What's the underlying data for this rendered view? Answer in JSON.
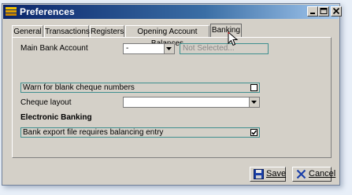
{
  "window": {
    "title": "Preferences",
    "icon": "stacked-bars-icon"
  },
  "tabs": [
    {
      "label": "General"
    },
    {
      "label": "Transactions"
    },
    {
      "label": "Registers"
    },
    {
      "label": "Opening Account Balances"
    },
    {
      "label": "Banking",
      "active": true
    }
  ],
  "banking": {
    "main_bank_account_label": "Main Bank Account",
    "main_bank_account_value": "-",
    "main_bank_account_display": "Not Selected...",
    "warn_blank_cheque_label": "Warn for blank cheque numbers",
    "warn_blank_cheque_checked": false,
    "cheque_layout_label": "Cheque layout",
    "cheque_layout_value": "",
    "electronic_banking_title": "Electronic Banking",
    "bank_export_label": "Bank export file requires balancing entry",
    "bank_export_checked": true
  },
  "buttons": {
    "save_label": "Save",
    "cancel_label": "Cancel"
  },
  "colors": {
    "title_bar_start": "#0a246a",
    "title_bar_end": "#a6caf0",
    "dialog_face": "#d4d0c8",
    "field_outline": "#3f8f8f",
    "cursor_accent": "#d02020"
  }
}
